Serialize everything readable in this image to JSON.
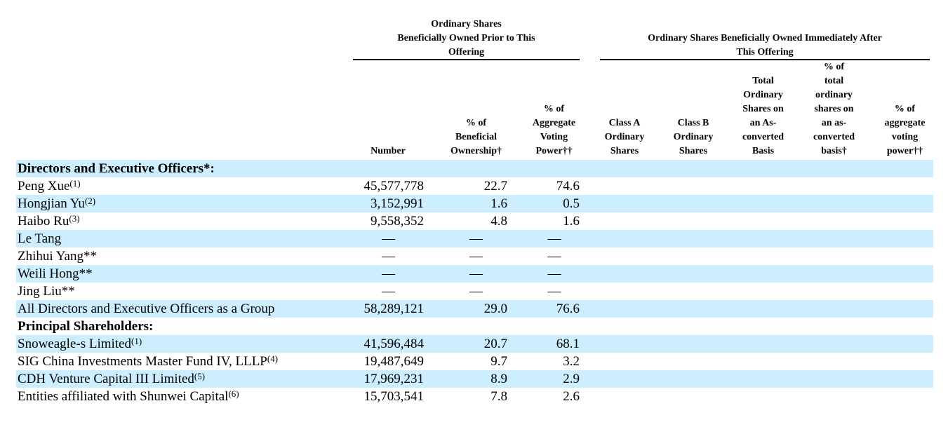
{
  "header": {
    "group_prior": [
      "Ordinary Shares",
      "Beneficially Owned Prior to This",
      "Offering"
    ],
    "group_after": [
      "Ordinary Shares Beneficially Owned Immediately After",
      "This Offering"
    ],
    "columns": [
      [
        "Number"
      ],
      [
        "% of",
        "Beneficial",
        "Ownership†"
      ],
      [
        "% of",
        "Aggregate",
        "Voting",
        "Power††"
      ],
      [
        "Class A",
        "Ordinary",
        "Shares"
      ],
      [
        "Class B",
        "Ordinary",
        "Shares"
      ],
      [
        "Total",
        "Ordinary",
        "Shares on",
        "an As-",
        "converted",
        "Basis"
      ],
      [
        "% of",
        "total",
        "ordinary",
        "shares on",
        "an as-",
        "converted",
        "basis†"
      ],
      [
        "% of",
        "aggregate",
        "voting",
        "power††"
      ]
    ]
  },
  "rows": [
    {
      "type": "section",
      "name": "Directors and Executive Officers*:"
    },
    {
      "type": "data",
      "name": "Peng Xue",
      "note": "(1)",
      "number": "45,577,778",
      "beneficial": "22.7",
      "voting": "74.6"
    },
    {
      "type": "data",
      "name": "Hongjian Yu",
      "note": "(2)",
      "number": "3,152,991",
      "beneficial": "1.6",
      "voting": "0.5"
    },
    {
      "type": "data",
      "name": "Haibo Ru",
      "note": "(3)",
      "number": "9,558,352",
      "beneficial": "4.8",
      "voting": "1.6"
    },
    {
      "type": "data",
      "name": "Le Tang",
      "note": "",
      "number": "—",
      "beneficial": "—",
      "voting": "—"
    },
    {
      "type": "data",
      "name": "Zhihui Yang**",
      "note": "",
      "number": "—",
      "beneficial": "—",
      "voting": "—"
    },
    {
      "type": "data",
      "name": "Weili Hong**",
      "note": "",
      "number": "—",
      "beneficial": "—",
      "voting": "—"
    },
    {
      "type": "data",
      "name": "Jing Liu**",
      "note": "",
      "number": "—",
      "beneficial": "—",
      "voting": "—"
    },
    {
      "type": "data",
      "name": "All Directors and Executive Officers as a Group",
      "note": "",
      "number": "58,289,121",
      "beneficial": "29.0",
      "voting": "76.6"
    },
    {
      "type": "section",
      "name": "Principal Shareholders:"
    },
    {
      "type": "data",
      "name": "Snoweagle-s Limited",
      "note": "(1)",
      "number": "41,596,484",
      "beneficial": "20.7",
      "voting": "68.1"
    },
    {
      "type": "data",
      "name": "SIG China Investments Master Fund IV, LLLP",
      "note": "(4)",
      "number": "19,487,649",
      "beneficial": "9.7",
      "voting": "3.2"
    },
    {
      "type": "data",
      "name": "CDH Venture Capital III Limited",
      "note": "(5)",
      "number": "17,969,231",
      "beneficial": "8.9",
      "voting": "2.9"
    },
    {
      "type": "data",
      "name": "Entities affiliated with Shunwei Capital",
      "note": "(6)",
      "number": "15,703,541",
      "beneficial": "7.8",
      "voting": "2.6"
    }
  ]
}
